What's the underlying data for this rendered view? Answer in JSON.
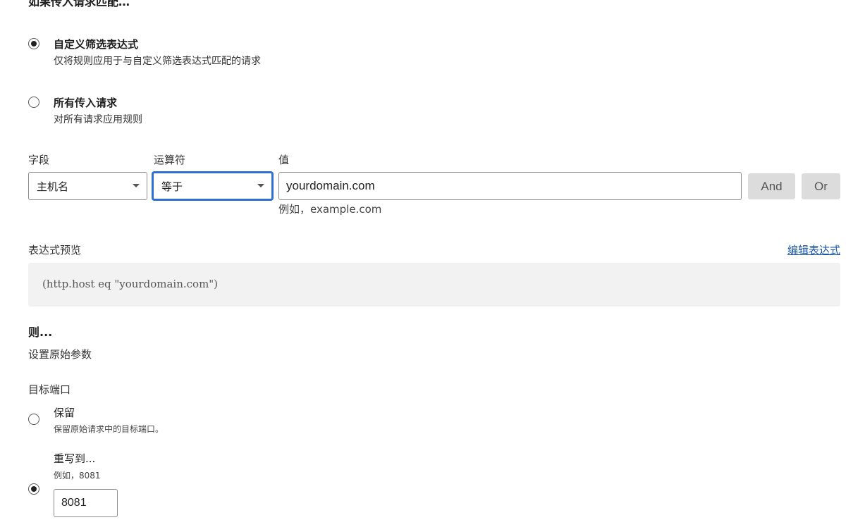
{
  "match": {
    "heading": "如果传入请求匹配…",
    "options": [
      {
        "title": "自定义筛选表达式",
        "description": "仅将规则应用于与自定义筛选表达式匹配的请求",
        "checked": true
      },
      {
        "title": "所有传入请求",
        "description": "对所有请求应用规则",
        "checked": false
      }
    ]
  },
  "filter": {
    "field_label": "字段",
    "operator_label": "运算符",
    "value_label": "值",
    "field_value": "主机名",
    "operator_value": "等于",
    "value_input": "yourdomain.com",
    "value_hint": "例如，example.com",
    "and_button": "And",
    "or_button": "Or"
  },
  "expression": {
    "label": "表达式预览",
    "edit_link": "编辑表达式",
    "code": "(http.host eq \"yourdomain.com\")"
  },
  "then": {
    "heading": "则...",
    "subtitle": "设置原始参数",
    "port_label": "目标端口",
    "options": [
      {
        "title": "保留",
        "description": "保留原始请求中的目标端口。",
        "checked": false
      },
      {
        "title": "重写到...",
        "description": "例如，8081",
        "checked": true
      }
    ],
    "port_value": "8081"
  }
}
